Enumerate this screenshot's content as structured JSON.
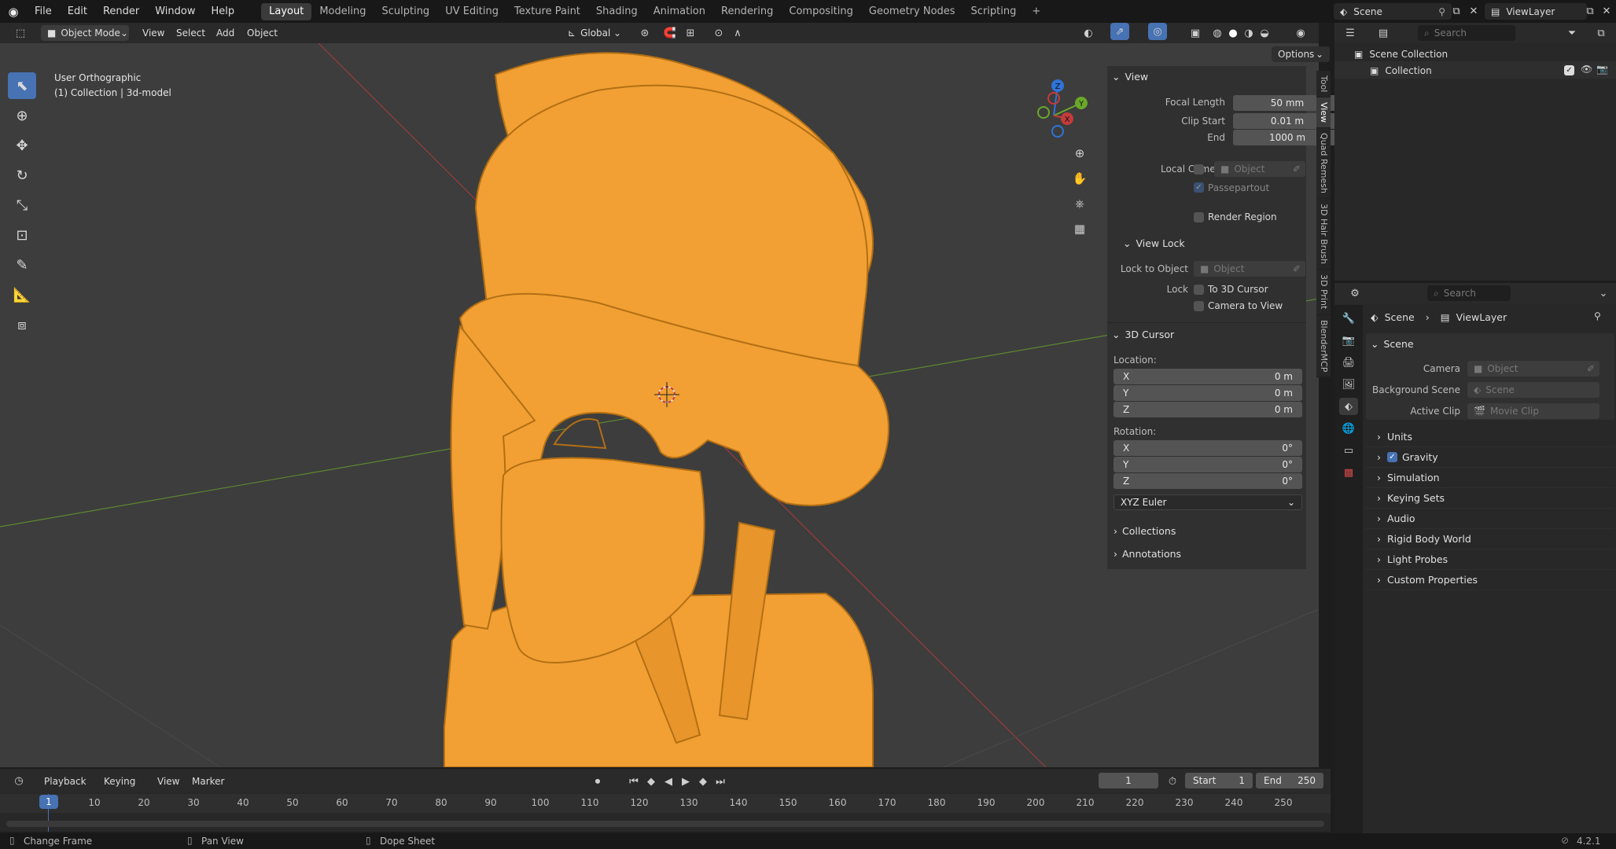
{
  "colors": {
    "accent": "#4772b3",
    "model": "#f2a033",
    "viewport": "#3d3d3d",
    "x_axis": "#c43b3b",
    "y_axis": "#6aa82a"
  },
  "menu": {
    "items": [
      "File",
      "Edit",
      "Render",
      "Window",
      "Help"
    ]
  },
  "workspaces": {
    "tabs": [
      "Layout",
      "Modeling",
      "Sculpting",
      "UV Editing",
      "Texture Paint",
      "Shading",
      "Animation",
      "Rendering",
      "Compositing",
      "Geometry Nodes",
      "Scripting"
    ],
    "active": "Layout",
    "add": "+"
  },
  "topright": {
    "scene": "Scene",
    "viewlayer": "ViewLayer"
  },
  "viewport_header": {
    "mode": "Object Mode",
    "menus": [
      "View",
      "Select",
      "Add",
      "Object"
    ],
    "orientation": "Global",
    "options": "Options"
  },
  "viewport": {
    "view_name": "User Orthographic",
    "collection_info": "(1) Collection | 3d-model"
  },
  "gizmo": {
    "z": "Z",
    "y": "Y",
    "x": "X"
  },
  "npanel": {
    "tabs": [
      "Tool",
      "View",
      "Quad Remesh",
      "3D Hair Brush",
      "3D Print",
      "BlenderMCP"
    ],
    "view": {
      "title": "View",
      "focal_label": "Focal Length",
      "focal": "50 mm",
      "clip_start_label": "Clip Start",
      "clip_start": "0.01 m",
      "end_label": "End",
      "end": "1000 m",
      "local_camera_label": "Local Camera",
      "object_placeholder": "Object",
      "passepartout": "Passepartout",
      "render_region": "Render Region"
    },
    "view_lock": {
      "title": "View Lock",
      "lock_to_object": "Lock to Object",
      "object_placeholder": "Object",
      "lock_label": "Lock",
      "to_cursor": "To 3D Cursor",
      "camera_to_view": "Camera to View"
    },
    "cursor": {
      "title": "3D Cursor",
      "location": "Location:",
      "rotation": "Rotation:",
      "x": "X",
      "y": "Y",
      "z": "Z",
      "loc_x": "0 m",
      "loc_y": "0 m",
      "loc_z": "0 m",
      "rot_x": "0°",
      "rot_y": "0°",
      "rot_z": "0°",
      "rot_mode": "XYZ Euler"
    },
    "collections": "Collections",
    "annotations": "Annotations"
  },
  "outliner": {
    "search": "Search",
    "scene_collection": "Scene Collection",
    "collection": "Collection"
  },
  "properties": {
    "search": "Search",
    "breadcrumb_scene": "Scene",
    "breadcrumb_viewlayer": "ViewLayer",
    "section": "Scene",
    "camera_label": "Camera",
    "camera_ph": "Object",
    "bg_label": "Background Scene",
    "bg_ph": "Scene",
    "clip_label": "Active Clip",
    "clip_ph": "Movie Clip",
    "rows": [
      "Units",
      "Gravity",
      "Simulation",
      "Keying Sets",
      "Audio",
      "Rigid Body World",
      "Light Probes",
      "Custom Properties"
    ]
  },
  "timeline": {
    "menus": [
      "Playback",
      "Keying",
      "View",
      "Marker"
    ],
    "current_frame": "1",
    "start_label": "Start",
    "start": "1",
    "end_label": "End",
    "end": "250",
    "ticks": [
      "10",
      "20",
      "30",
      "40",
      "50",
      "60",
      "70",
      "80",
      "90",
      "100",
      "110",
      "120",
      "130",
      "140",
      "150",
      "160",
      "170",
      "180",
      "190",
      "200",
      "210",
      "220",
      "230",
      "240",
      "250"
    ],
    "playhead": "1"
  },
  "status": {
    "change_frame": "Change Frame",
    "pan_view": "Pan View",
    "dope_sheet": "Dope Sheet",
    "version": "4.2.1"
  }
}
